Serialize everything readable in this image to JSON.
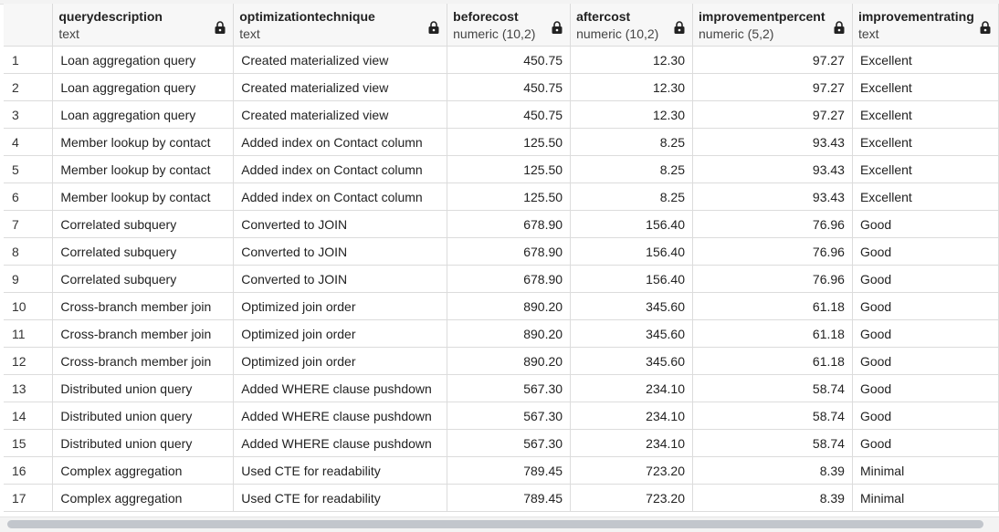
{
  "columns": [
    {
      "name": "querydescription",
      "type": "text"
    },
    {
      "name": "optimizationtechnique",
      "type": "text"
    },
    {
      "name": "beforecost",
      "type": "numeric (10,2)"
    },
    {
      "name": "aftercost",
      "type": "numeric (10,2)"
    },
    {
      "name": "improvementpercent",
      "type": "numeric (5,2)"
    },
    {
      "name": "improvementrating",
      "type": "text"
    }
  ],
  "rows": [
    {
      "n": "1",
      "c": [
        "Loan aggregation query",
        "Created materialized view",
        "450.75",
        "12.30",
        "97.27",
        "Excellent"
      ]
    },
    {
      "n": "2",
      "c": [
        "Loan aggregation query",
        "Created materialized view",
        "450.75",
        "12.30",
        "97.27",
        "Excellent"
      ]
    },
    {
      "n": "3",
      "c": [
        "Loan aggregation query",
        "Created materialized view",
        "450.75",
        "12.30",
        "97.27",
        "Excellent"
      ]
    },
    {
      "n": "4",
      "c": [
        "Member lookup by contact",
        "Added index on Contact column",
        "125.50",
        "8.25",
        "93.43",
        "Excellent"
      ]
    },
    {
      "n": "5",
      "c": [
        "Member lookup by contact",
        "Added index on Contact column",
        "125.50",
        "8.25",
        "93.43",
        "Excellent"
      ]
    },
    {
      "n": "6",
      "c": [
        "Member lookup by contact",
        "Added index on Contact column",
        "125.50",
        "8.25",
        "93.43",
        "Excellent"
      ]
    },
    {
      "n": "7",
      "c": [
        "Correlated subquery",
        "Converted to JOIN",
        "678.90",
        "156.40",
        "76.96",
        "Good"
      ]
    },
    {
      "n": "8",
      "c": [
        "Correlated subquery",
        "Converted to JOIN",
        "678.90",
        "156.40",
        "76.96",
        "Good"
      ]
    },
    {
      "n": "9",
      "c": [
        "Correlated subquery",
        "Converted to JOIN",
        "678.90",
        "156.40",
        "76.96",
        "Good"
      ]
    },
    {
      "n": "10",
      "c": [
        "Cross-branch member join",
        "Optimized join order",
        "890.20",
        "345.60",
        "61.18",
        "Good"
      ]
    },
    {
      "n": "11",
      "c": [
        "Cross-branch member join",
        "Optimized join order",
        "890.20",
        "345.60",
        "61.18",
        "Good"
      ]
    },
    {
      "n": "12",
      "c": [
        "Cross-branch member join",
        "Optimized join order",
        "890.20",
        "345.60",
        "61.18",
        "Good"
      ]
    },
    {
      "n": "13",
      "c": [
        "Distributed union query",
        "Added WHERE clause pushdown",
        "567.30",
        "234.10",
        "58.74",
        "Good"
      ]
    },
    {
      "n": "14",
      "c": [
        "Distributed union query",
        "Added WHERE clause pushdown",
        "567.30",
        "234.10",
        "58.74",
        "Good"
      ]
    },
    {
      "n": "15",
      "c": [
        "Distributed union query",
        "Added WHERE clause pushdown",
        "567.30",
        "234.10",
        "58.74",
        "Good"
      ]
    },
    {
      "n": "16",
      "c": [
        "Complex aggregation",
        "Used CTE for readability",
        "789.45",
        "723.20",
        "8.39",
        "Minimal"
      ]
    },
    {
      "n": "17",
      "c": [
        "Complex aggregation",
        "Used CTE for readability",
        "789.45",
        "723.20",
        "8.39",
        "Minimal"
      ]
    }
  ],
  "icons": {
    "column_lock": "lock-icon"
  },
  "colors": {
    "grid_line": "#dcdcdc",
    "header_bg": "#f7f7f7",
    "scroll_thumb": "#c2c6cc"
  }
}
